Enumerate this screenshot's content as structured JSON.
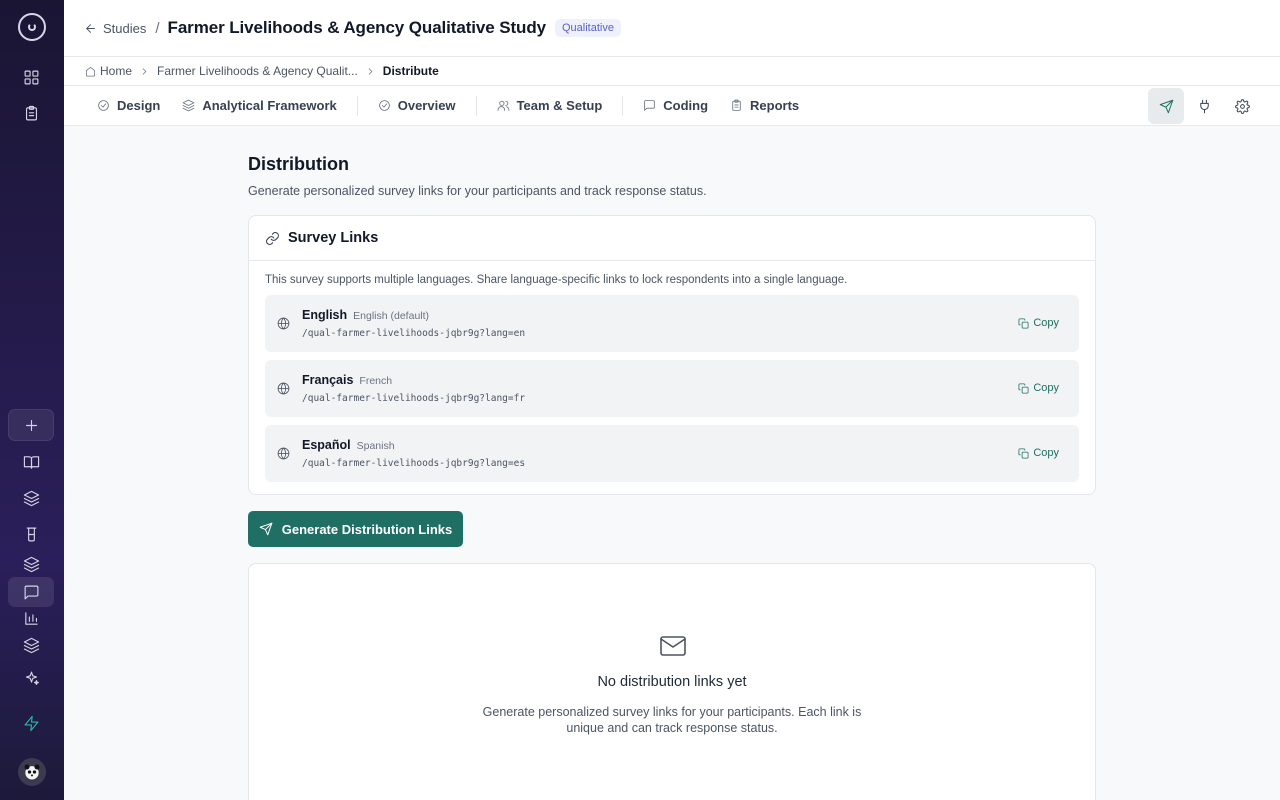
{
  "header": {
    "back_label": "Studies",
    "separator": "/",
    "title": "Farmer Livelihoods & Agency Qualitative Study",
    "badge": "Qualitative"
  },
  "breadcrumb": {
    "items": [
      "Home",
      "Farmer Livelihoods & Agency Qualit...",
      "Distribute"
    ]
  },
  "tabs": [
    {
      "label": "Design",
      "icon": "check-circle-icon"
    },
    {
      "label": "Analytical Framework",
      "icon": "layers-icon"
    },
    {
      "label": "Overview",
      "icon": "check-circle-icon"
    },
    {
      "label": "Team & Setup",
      "icon": "users-icon"
    },
    {
      "label": "Coding",
      "icon": "message-square-icon"
    },
    {
      "label": "Reports",
      "icon": "clipboard-icon"
    }
  ],
  "page": {
    "title": "Distribution",
    "subtitle": "Generate personalized survey links for your participants and track response status."
  },
  "survey_links": {
    "title": "Survey Links",
    "note": "This survey supports multiple languages. Share language-specific links to lock respondents into a single language.",
    "copy_label": "Copy",
    "languages": [
      {
        "name": "English",
        "label": "English (default)",
        "path": "/qual-farmer-livelihoods-jqbr9g?lang=en"
      },
      {
        "name": "Français",
        "label": "French",
        "path": "/qual-farmer-livelihoods-jqbr9g?lang=fr"
      },
      {
        "name": "Español",
        "label": "Spanish",
        "path": "/qual-farmer-livelihoods-jqbr9g?lang=es"
      }
    ]
  },
  "generate_button": "Generate Distribution Links",
  "empty_state": {
    "title": "No distribution links yet",
    "description": "Generate personalized survey links for your participants. Each link is unique and can track response status."
  },
  "colors": {
    "accent": "#1f6f64",
    "badge_text": "#5b61c9",
    "sidebar": "#241b4a"
  }
}
